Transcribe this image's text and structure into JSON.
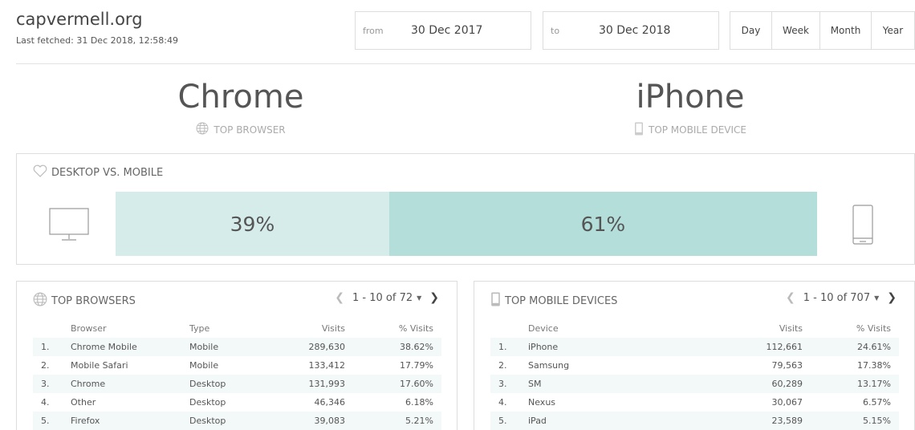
{
  "header": {
    "site": "capvermell.org",
    "last_fetched": "Last fetched: 31 Dec 2018, 12:58:49",
    "from_label": "from",
    "from_value": "30 Dec 2017",
    "to_label": "to",
    "to_value": "30 Dec 2018",
    "ranges": [
      "Day",
      "Week",
      "Month",
      "Year"
    ]
  },
  "highlights": {
    "browser_name": "Chrome",
    "browser_label": "TOP BROWSER",
    "device_name": "iPhone",
    "device_label": "TOP MOBILE DEVICE"
  },
  "desktop_mobile": {
    "title": "DESKTOP VS. MOBILE",
    "desktop_pct": 39,
    "mobile_pct": 61,
    "desktop_label": "39%",
    "mobile_label": "61%"
  },
  "browsers": {
    "title": "TOP BROWSERS",
    "pager": "1 - 10 of 72",
    "columns": [
      "Browser",
      "Type",
      "Visits",
      "% Visits"
    ],
    "rows": [
      [
        "1.",
        "Chrome Mobile",
        "Mobile",
        "289,630",
        "38.62%"
      ],
      [
        "2.",
        "Mobile Safari",
        "Mobile",
        "133,412",
        "17.79%"
      ],
      [
        "3.",
        "Chrome",
        "Desktop",
        "131,993",
        "17.60%"
      ],
      [
        "4.",
        "Other",
        "Desktop",
        "46,346",
        "6.18%"
      ],
      [
        "5.",
        "Firefox",
        "Desktop",
        "39,083",
        "5.21%"
      ]
    ]
  },
  "devices": {
    "title": "TOP MOBILE DEVICES",
    "pager": "1 - 10 of 707",
    "columns": [
      "Device",
      "Visits",
      "% Visits"
    ],
    "rows": [
      [
        "1.",
        "iPhone",
        "112,661",
        "24.61%"
      ],
      [
        "2.",
        "Samsung",
        "79,563",
        "17.38%"
      ],
      [
        "3.",
        "SM",
        "60,289",
        "13.17%"
      ],
      [
        "4.",
        "Nexus",
        "30,067",
        "6.57%"
      ],
      [
        "5.",
        "iPad",
        "23,589",
        "5.15%"
      ]
    ]
  },
  "icons": {
    "globe": "globe-icon",
    "phone": "phone-icon",
    "heart": "heart-icon",
    "monitor": "monitor-icon",
    "chevron_left": "chevron-left-icon",
    "chevron_right": "chevron-right-icon",
    "caret": "caret-down-icon"
  },
  "colors": {
    "desktop_bar": "#d6ecea",
    "mobile_bar": "#b3deda",
    "row_stripe": "#f3f9f8"
  }
}
